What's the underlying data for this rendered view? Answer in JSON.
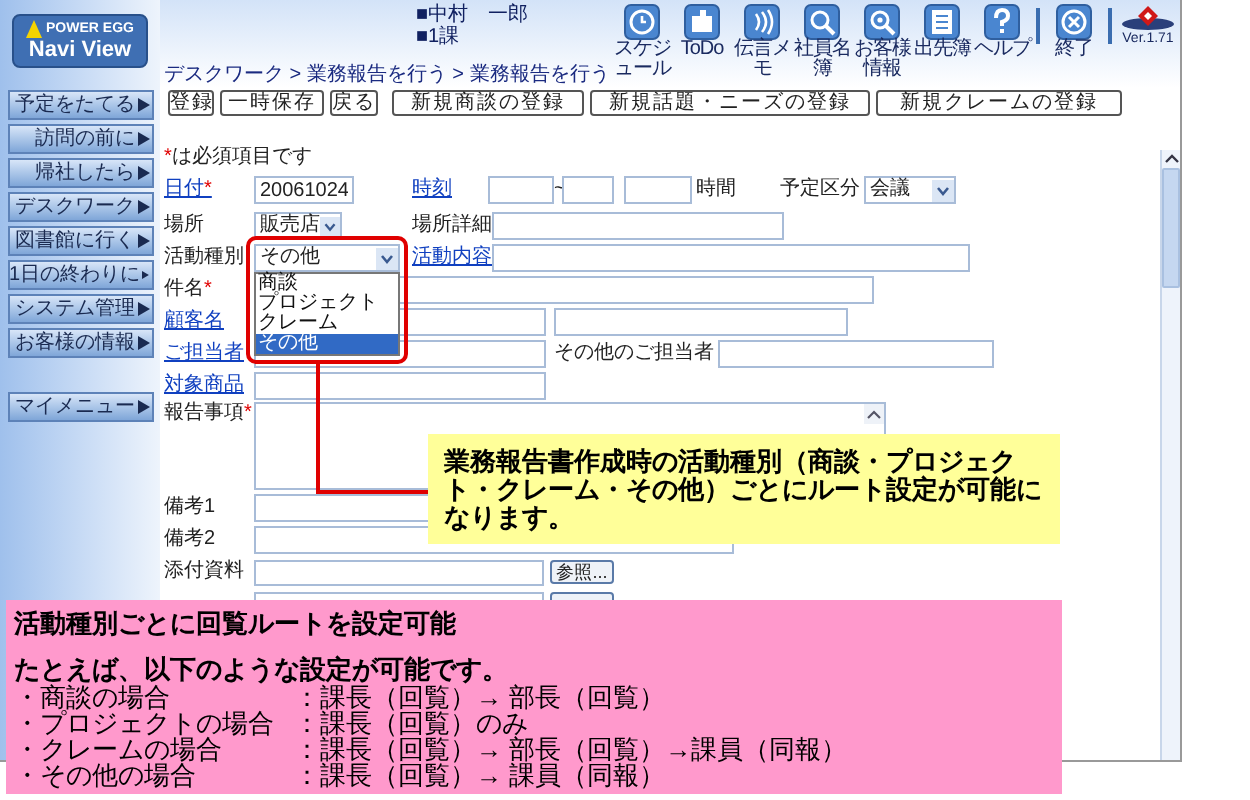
{
  "user": {
    "name": "■中村　一郎",
    "group": "■1課"
  },
  "logo": {
    "line1": "POWER EGG",
    "line2": "Navi View"
  },
  "toolbar": [
    {
      "kind": "clock",
      "label": "スケジュール"
    },
    {
      "kind": "todo",
      "label": "ToDo"
    },
    {
      "kind": "memo",
      "label": "伝言メモ"
    },
    {
      "kind": "search",
      "label": "社員名簿"
    },
    {
      "kind": "customer",
      "label": "お客様情報"
    },
    {
      "kind": "list",
      "label": "出先簿"
    },
    {
      "kind": "help",
      "label": "ヘルプ"
    },
    {
      "kind": "exit",
      "label": "終了"
    }
  ],
  "version": "Ver.1.71",
  "breadcrumb": "デスクワーク > 業務報告を行う > 業務報告を行う",
  "buttons": [
    "登録",
    "一時保存",
    "戻る",
    "新規商談の登録",
    "新規話題・ニーズの登録",
    "新規クレームの登録"
  ],
  "sidebar": {
    "items": [
      "予定をたてる",
      "訪問の前に",
      "帰社したら",
      "デスクワーク",
      "図書館に行く",
      "1日の終わりに",
      "システム管理",
      "お客様の情報"
    ],
    "my_menu": "マイメニュー"
  },
  "form": {
    "required_note": {
      "mark": "*",
      "text": "は必須項目です"
    },
    "date": {
      "label": {
        "text": "日付",
        "link": true,
        "mark": "*"
      },
      "value": "20061024"
    },
    "time": {
      "label": {
        "text": "時刻",
        "link": true
      },
      "separator": "~",
      "unit": "時間"
    },
    "schedule_type": {
      "label": {
        "text": "予定区分",
        "link": false
      },
      "value": "会議"
    },
    "place": {
      "label": {
        "text": "場所",
        "link": false
      },
      "value": "販売店"
    },
    "place_detail": {
      "label": {
        "text": "場所詳細",
        "link": false
      }
    },
    "activity_type": {
      "label": {
        "text": "活動種別",
        "link": false
      },
      "value": "その他",
      "options": [
        {
          "text": "商談",
          "selected": false
        },
        {
          "text": "プロジェクト",
          "selected": false
        },
        {
          "text": "クレーム",
          "selected": false
        },
        {
          "text": "その他",
          "selected": true
        }
      ]
    },
    "activity_content": {
      "label": {
        "text": "活動内容",
        "link": true
      }
    },
    "subject": {
      "label": {
        "text": "件名",
        "link": false,
        "mark": "*"
      }
    },
    "customer": {
      "label": {
        "text": "顧客名",
        "link": true
      }
    },
    "contact": {
      "label": {
        "text": "ご担当者",
        "link": true
      },
      "other_label": "その他のご担当者"
    },
    "product": {
      "label": {
        "text": "対象商品",
        "link": true
      }
    },
    "report": {
      "label": {
        "text": "報告事項",
        "link": false,
        "mark": "*"
      }
    },
    "remarks1": {
      "label": {
        "text": "備考1",
        "link": false
      }
    },
    "remarks2": {
      "label": {
        "text": "備考2",
        "link": false
      }
    },
    "attachment": {
      "label": {
        "text": "添付資料",
        "link": false
      },
      "button": "参照..."
    }
  },
  "callout": "業務報告書作成時の活動種別（商談・プロジェクト・クレーム・その他）ごとにルート設定が可能になります。",
  "note": {
    "title": "活動種別ごとに回覧ルートを設定可能",
    "intro": "たとえば、以下のような設定が可能です。",
    "lines": [
      {
        "case": "・商談の場合",
        "route": "：課長（回覧）→ 部長（回覧）"
      },
      {
        "case": "・プロジェクトの場合",
        "route": "：課長（回覧）のみ"
      },
      {
        "case": "・クレームの場合",
        "route": "：課長（回覧）→ 部長（回覧）→課員（同報）"
      },
      {
        "case": "・その他の場合",
        "route": "：課長（回覧）→ 課員（同報）"
      }
    ]
  }
}
